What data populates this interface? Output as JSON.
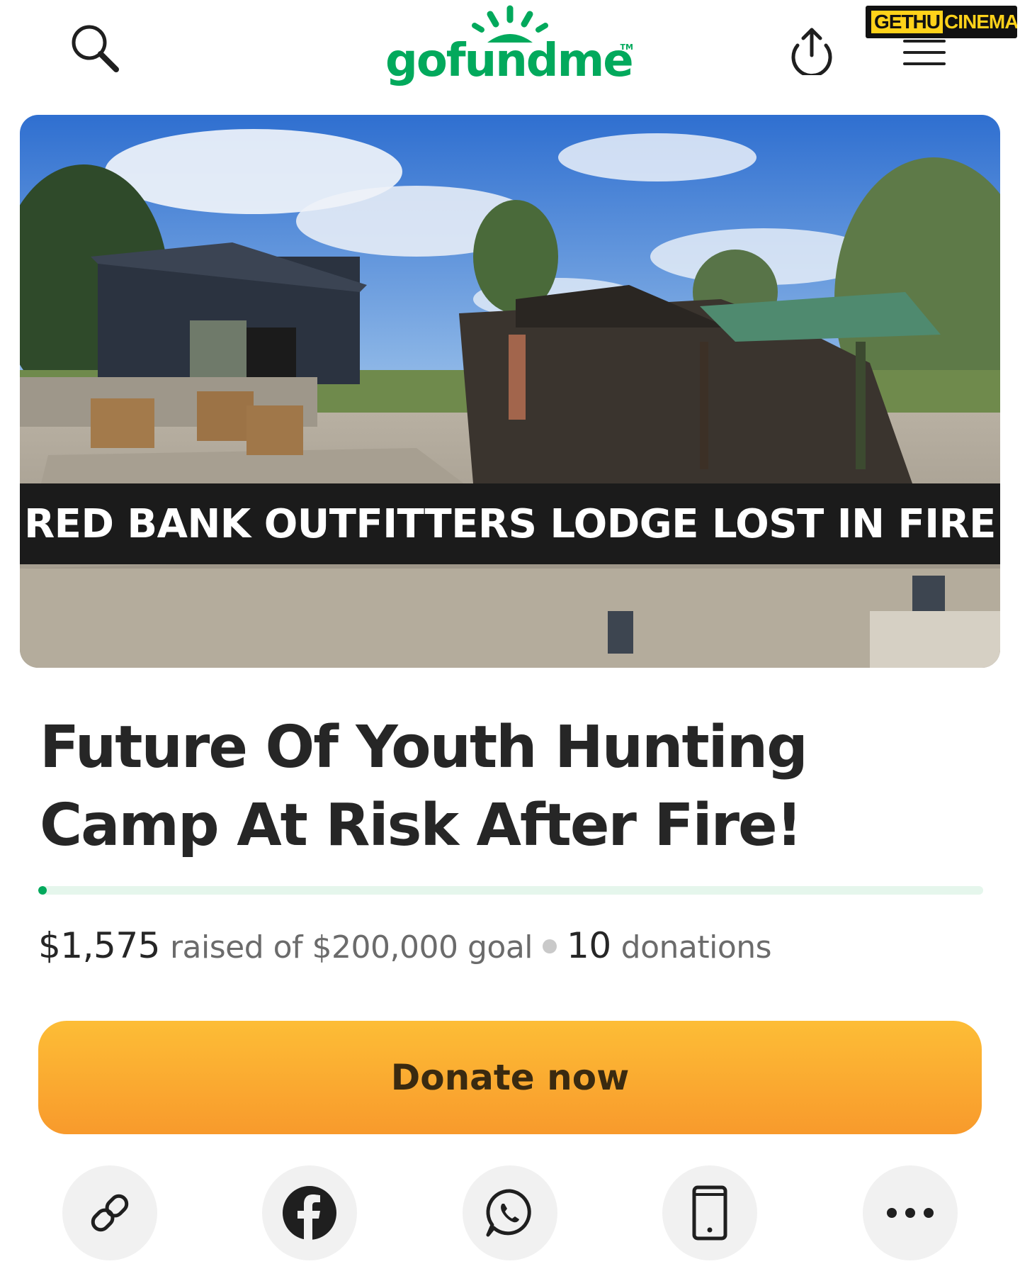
{
  "header": {
    "logo_text": "gofundme",
    "logo_tm": "TM",
    "watermark_part1": "GETHU",
    "watermark_part2": "CINEMA"
  },
  "hero": {
    "banner_text": "RED BANK OUTFITTERS LODGE LOST IN FIRE"
  },
  "campaign": {
    "title": "Future Of Youth Hunting Camp At Risk After Fire!",
    "raised_amount": "$1,575",
    "raised_label": "raised of $200,000 goal",
    "donation_count": "10",
    "donation_label": "donations",
    "progress_fraction": 0.0079
  },
  "actions": {
    "donate_label": "Donate now"
  },
  "share_options": [
    {
      "name": "copy-link",
      "icon": "link-icon"
    },
    {
      "name": "facebook",
      "icon": "facebook-icon"
    },
    {
      "name": "whatsapp",
      "icon": "whatsapp-icon"
    },
    {
      "name": "sms",
      "icon": "phone-icon"
    },
    {
      "name": "more",
      "icon": "more-icon"
    }
  ],
  "colors": {
    "brand_green": "#02a95c",
    "donate_orange": "#f9a830",
    "progress_track": "#e5f6ec"
  }
}
